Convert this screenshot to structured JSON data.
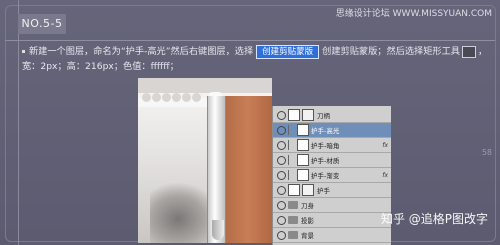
{
  "step_badge": "NO.5-5",
  "watermark_top": "思缘设计论坛 WWW.MISSYUAN.COM",
  "instruction": {
    "part1": "新建一个图层，命名为“护手-高光”然后右键图层，选择",
    "button": "创建剪贴蒙版",
    "part2": "创建剪贴蒙版；然后选择矩形工具",
    "part3": "，宽：2px；高：216px；色值：ffffff；"
  },
  "page_number": "58",
  "layers": [
    {
      "name": "刀柄",
      "type": "layer",
      "fx": "",
      "active": false
    },
    {
      "name": "护手-高光",
      "type": "layer",
      "fx": "",
      "active": true
    },
    {
      "name": "护手-暗角",
      "type": "layer",
      "fx": "fx",
      "active": false
    },
    {
      "name": "护手-材质",
      "type": "layer",
      "fx": "",
      "active": false
    },
    {
      "name": "护手-渐变",
      "type": "layer",
      "fx": "fx",
      "active": false
    },
    {
      "name": "护手",
      "type": "layer",
      "fx": "",
      "active": false
    },
    {
      "name": "刀身",
      "type": "folder",
      "fx": "",
      "active": false
    },
    {
      "name": "投影",
      "type": "folder",
      "fx": "",
      "active": false
    },
    {
      "name": "背景",
      "type": "folder",
      "fx": "",
      "active": false
    }
  ],
  "footer_watermark": "知乎 @追格P图改字"
}
